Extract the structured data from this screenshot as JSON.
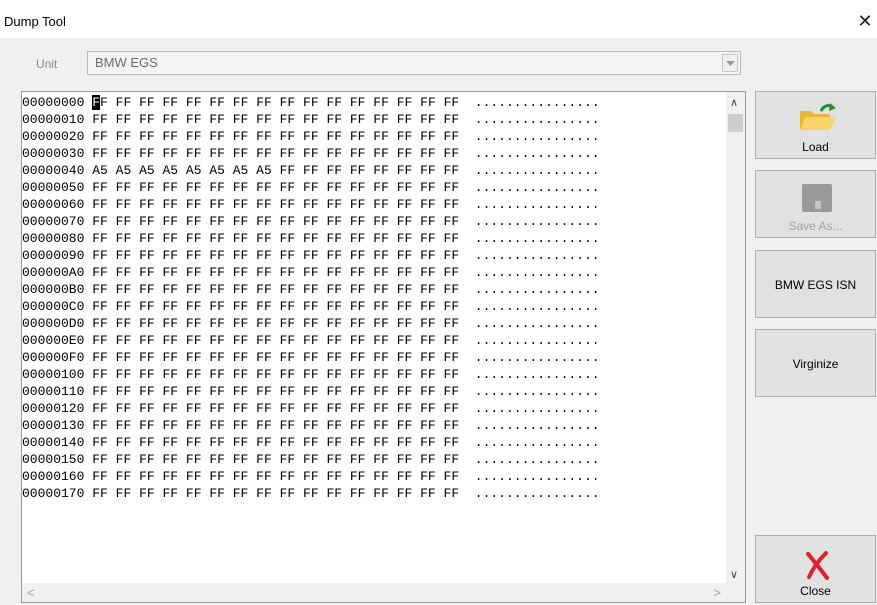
{
  "window": {
    "title": "Dump Tool",
    "close_glyph": "✕"
  },
  "unit": {
    "label": "Unit",
    "value": "BMW EGS"
  },
  "hex": {
    "lines": [
      {
        "addr": "00000000",
        "bytes": [
          "FF",
          "FF",
          "FF",
          "FF",
          "FF",
          "FF",
          "FF",
          "FF",
          "FF",
          "FF",
          "FF",
          "FF",
          "FF",
          "FF",
          "FF",
          "FF"
        ],
        "ascii": "................"
      },
      {
        "addr": "00000010",
        "bytes": [
          "FF",
          "FF",
          "FF",
          "FF",
          "FF",
          "FF",
          "FF",
          "FF",
          "FF",
          "FF",
          "FF",
          "FF",
          "FF",
          "FF",
          "FF",
          "FF"
        ],
        "ascii": "................"
      },
      {
        "addr": "00000020",
        "bytes": [
          "FF",
          "FF",
          "FF",
          "FF",
          "FF",
          "FF",
          "FF",
          "FF",
          "FF",
          "FF",
          "FF",
          "FF",
          "FF",
          "FF",
          "FF",
          "FF"
        ],
        "ascii": "................"
      },
      {
        "addr": "00000030",
        "bytes": [
          "FF",
          "FF",
          "FF",
          "FF",
          "FF",
          "FF",
          "FF",
          "FF",
          "FF",
          "FF",
          "FF",
          "FF",
          "FF",
          "FF",
          "FF",
          "FF"
        ],
        "ascii": "................"
      },
      {
        "addr": "00000040",
        "bytes": [
          "A5",
          "A5",
          "A5",
          "A5",
          "A5",
          "A5",
          "A5",
          "A5",
          "FF",
          "FF",
          "FF",
          "FF",
          "FF",
          "FF",
          "FF",
          "FF"
        ],
        "ascii": "................"
      },
      {
        "addr": "00000050",
        "bytes": [
          "FF",
          "FF",
          "FF",
          "FF",
          "FF",
          "FF",
          "FF",
          "FF",
          "FF",
          "FF",
          "FF",
          "FF",
          "FF",
          "FF",
          "FF",
          "FF"
        ],
        "ascii": "................"
      },
      {
        "addr": "00000060",
        "bytes": [
          "FF",
          "FF",
          "FF",
          "FF",
          "FF",
          "FF",
          "FF",
          "FF",
          "FF",
          "FF",
          "FF",
          "FF",
          "FF",
          "FF",
          "FF",
          "FF"
        ],
        "ascii": "................"
      },
      {
        "addr": "00000070",
        "bytes": [
          "FF",
          "FF",
          "FF",
          "FF",
          "FF",
          "FF",
          "FF",
          "FF",
          "FF",
          "FF",
          "FF",
          "FF",
          "FF",
          "FF",
          "FF",
          "FF"
        ],
        "ascii": "................"
      },
      {
        "addr": "00000080",
        "bytes": [
          "FF",
          "FF",
          "FF",
          "FF",
          "FF",
          "FF",
          "FF",
          "FF",
          "FF",
          "FF",
          "FF",
          "FF",
          "FF",
          "FF",
          "FF",
          "FF"
        ],
        "ascii": "................"
      },
      {
        "addr": "00000090",
        "bytes": [
          "FF",
          "FF",
          "FF",
          "FF",
          "FF",
          "FF",
          "FF",
          "FF",
          "FF",
          "FF",
          "FF",
          "FF",
          "FF",
          "FF",
          "FF",
          "FF"
        ],
        "ascii": "................"
      },
      {
        "addr": "000000A0",
        "bytes": [
          "FF",
          "FF",
          "FF",
          "FF",
          "FF",
          "FF",
          "FF",
          "FF",
          "FF",
          "FF",
          "FF",
          "FF",
          "FF",
          "FF",
          "FF",
          "FF"
        ],
        "ascii": "................"
      },
      {
        "addr": "000000B0",
        "bytes": [
          "FF",
          "FF",
          "FF",
          "FF",
          "FF",
          "FF",
          "FF",
          "FF",
          "FF",
          "FF",
          "FF",
          "FF",
          "FF",
          "FF",
          "FF",
          "FF"
        ],
        "ascii": "................"
      },
      {
        "addr": "000000C0",
        "bytes": [
          "FF",
          "FF",
          "FF",
          "FF",
          "FF",
          "FF",
          "FF",
          "FF",
          "FF",
          "FF",
          "FF",
          "FF",
          "FF",
          "FF",
          "FF",
          "FF"
        ],
        "ascii": "................"
      },
      {
        "addr": "000000D0",
        "bytes": [
          "FF",
          "FF",
          "FF",
          "FF",
          "FF",
          "FF",
          "FF",
          "FF",
          "FF",
          "FF",
          "FF",
          "FF",
          "FF",
          "FF",
          "FF",
          "FF"
        ],
        "ascii": "................"
      },
      {
        "addr": "000000E0",
        "bytes": [
          "FF",
          "FF",
          "FF",
          "FF",
          "FF",
          "FF",
          "FF",
          "FF",
          "FF",
          "FF",
          "FF",
          "FF",
          "FF",
          "FF",
          "FF",
          "FF"
        ],
        "ascii": "................"
      },
      {
        "addr": "000000F0",
        "bytes": [
          "FF",
          "FF",
          "FF",
          "FF",
          "FF",
          "FF",
          "FF",
          "FF",
          "FF",
          "FF",
          "FF",
          "FF",
          "FF",
          "FF",
          "FF",
          "FF"
        ],
        "ascii": "................"
      },
      {
        "addr": "00000100",
        "bytes": [
          "FF",
          "FF",
          "FF",
          "FF",
          "FF",
          "FF",
          "FF",
          "FF",
          "FF",
          "FF",
          "FF",
          "FF",
          "FF",
          "FF",
          "FF",
          "FF"
        ],
        "ascii": "................"
      },
      {
        "addr": "00000110",
        "bytes": [
          "FF",
          "FF",
          "FF",
          "FF",
          "FF",
          "FF",
          "FF",
          "FF",
          "FF",
          "FF",
          "FF",
          "FF",
          "FF",
          "FF",
          "FF",
          "FF"
        ],
        "ascii": "................"
      },
      {
        "addr": "00000120",
        "bytes": [
          "FF",
          "FF",
          "FF",
          "FF",
          "FF",
          "FF",
          "FF",
          "FF",
          "FF",
          "FF",
          "FF",
          "FF",
          "FF",
          "FF",
          "FF",
          "FF"
        ],
        "ascii": "................"
      },
      {
        "addr": "00000130",
        "bytes": [
          "FF",
          "FF",
          "FF",
          "FF",
          "FF",
          "FF",
          "FF",
          "FF",
          "FF",
          "FF",
          "FF",
          "FF",
          "FF",
          "FF",
          "FF",
          "FF"
        ],
        "ascii": "................"
      },
      {
        "addr": "00000140",
        "bytes": [
          "FF",
          "FF",
          "FF",
          "FF",
          "FF",
          "FF",
          "FF",
          "FF",
          "FF",
          "FF",
          "FF",
          "FF",
          "FF",
          "FF",
          "FF",
          "FF"
        ],
        "ascii": "................"
      },
      {
        "addr": "00000150",
        "bytes": [
          "FF",
          "FF",
          "FF",
          "FF",
          "FF",
          "FF",
          "FF",
          "FF",
          "FF",
          "FF",
          "FF",
          "FF",
          "FF",
          "FF",
          "FF",
          "FF"
        ],
        "ascii": "................"
      },
      {
        "addr": "00000160",
        "bytes": [
          "FF",
          "FF",
          "FF",
          "FF",
          "FF",
          "FF",
          "FF",
          "FF",
          "FF",
          "FF",
          "FF",
          "FF",
          "FF",
          "FF",
          "FF",
          "FF"
        ],
        "ascii": "................"
      },
      {
        "addr": "00000170",
        "bytes": [
          "FF",
          "FF",
          "FF",
          "FF",
          "FF",
          "FF",
          "FF",
          "FF",
          "FF",
          "FF",
          "FF",
          "FF",
          "FF",
          "FF",
          "FF",
          "FF"
        ],
        "ascii": "................"
      }
    ]
  },
  "scrollbar": {
    "up": "∧",
    "down": "∨",
    "left": "<",
    "right": ">"
  },
  "buttons": {
    "load": {
      "label": "Load",
      "icon": "folder-open-icon"
    },
    "save_as": {
      "label": "Save As...",
      "icon": "save-disk-icon"
    },
    "isn": {
      "label": "BMW EGS ISN"
    },
    "virginize": {
      "label": "Virginize"
    },
    "close": {
      "label": "Close",
      "icon": "red-x-icon"
    }
  },
  "colors": {
    "folder": "#f4c542",
    "arrow": "#2e8b2e",
    "close_x": "#d9232e",
    "disabled": "#a0a0a0"
  }
}
